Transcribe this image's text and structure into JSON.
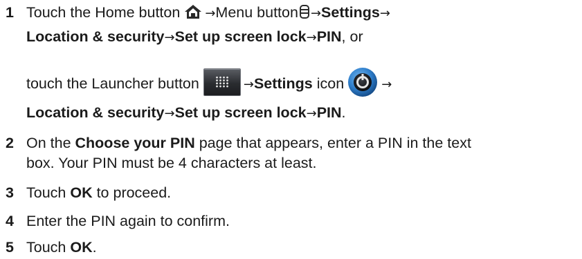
{
  "steps": [
    {
      "number": "1",
      "line1": {
        "pre": "Touch the Home button",
        "mid": "Menu button",
        "settings": "Settings"
      },
      "line2": {
        "location": "Location & security",
        "screen_lock": "Set up screen lock",
        "pin": "PIN",
        "suffix": ", or"
      },
      "line3": {
        "pre": "touch the Launcher button",
        "settings": "Settings",
        "icon_word": " icon"
      },
      "line4": {
        "location": "Location & security",
        "screen_lock": "Set up screen lock",
        "pin": "PIN",
        "suffix": "."
      }
    },
    {
      "number": "2",
      "pre": "On the ",
      "bold": "Choose your PIN",
      "post": " page that appears, enter a PIN in the text",
      "line2": "box. Your PIN must be 4 characters at least."
    },
    {
      "number": "3",
      "pre": "Touch ",
      "bold": "OK",
      "post": " to proceed."
    },
    {
      "number": "4",
      "text": "Enter the PIN again to confirm."
    },
    {
      "number": "5",
      "pre": "Touch ",
      "bold": "OK",
      "post": "."
    }
  ],
  "arrow": "→",
  "icons": {
    "home": "home-icon",
    "menu": "menu-icon",
    "launcher": "launcher-grid-icon",
    "settings": "settings-gear-icon"
  }
}
